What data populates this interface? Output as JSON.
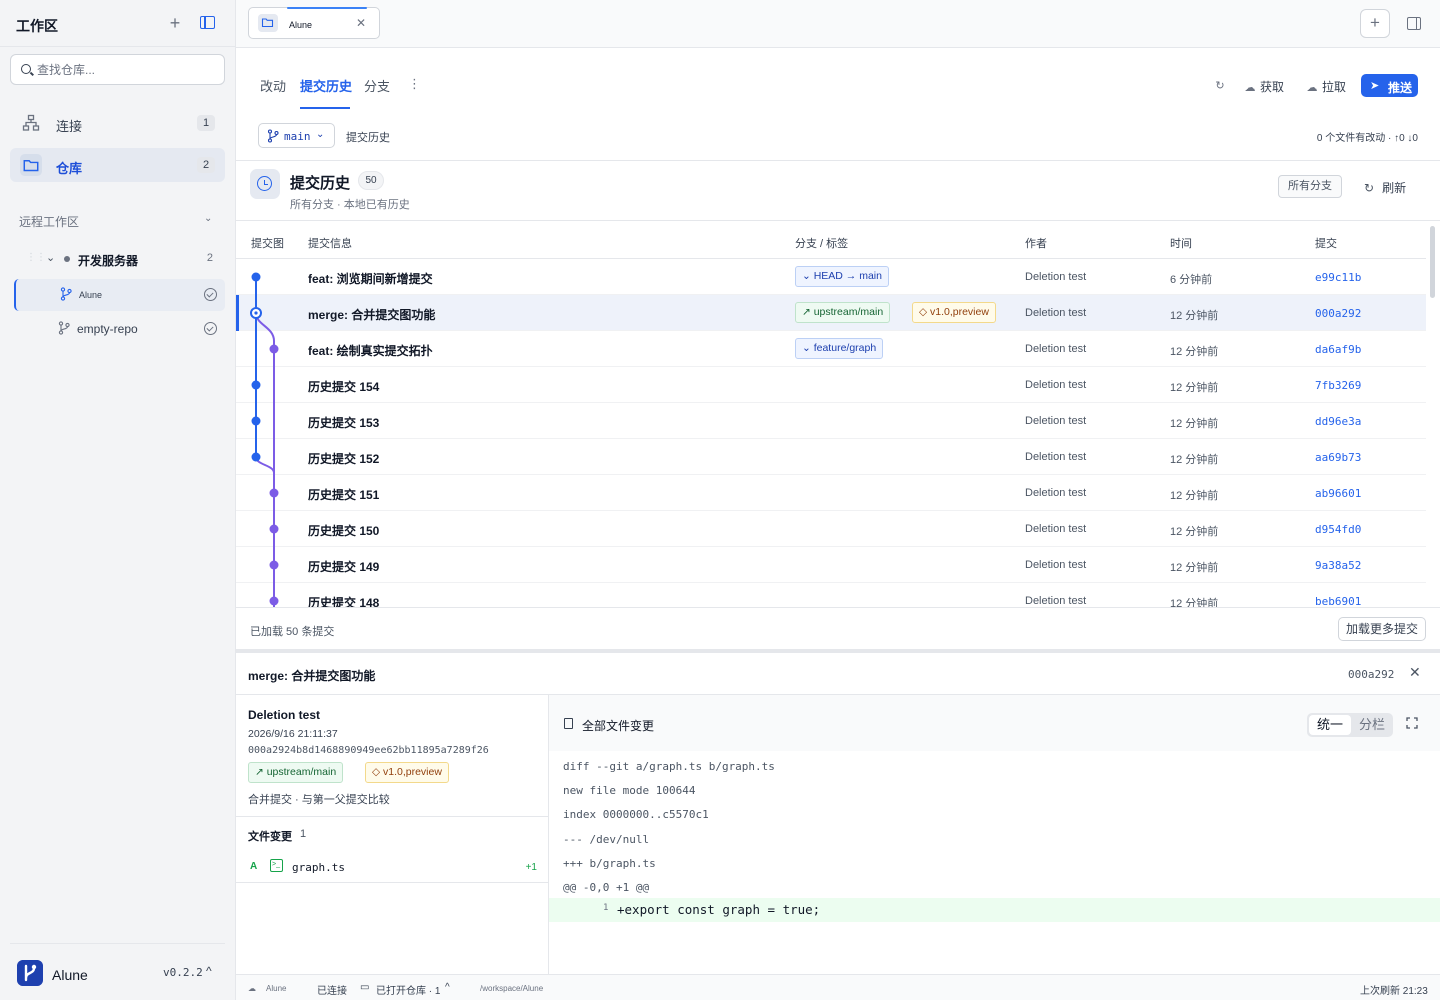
{
  "sidebar": {
    "title": "工作区",
    "search_placeholder": "查找仓库...",
    "nav": [
      {
        "label": "连接",
        "count": "1",
        "icon": "network-icon"
      },
      {
        "label": "仓库",
        "count": "2",
        "icon": "folder-icon"
      }
    ],
    "remote_section": "远程工作区",
    "server": {
      "label": "开发服务器",
      "count": "2"
    },
    "repos": [
      {
        "label": "Alune",
        "active": true
      },
      {
        "label": "empty-repo",
        "active": false
      }
    ],
    "footer": {
      "app_name": "Alune",
      "version": "v0.2.2"
    }
  },
  "tabbar": {
    "repo_tab": "Alune"
  },
  "subtabs": {
    "changes": "改动",
    "history": "提交历史",
    "branches": "分支",
    "fetch": "获取",
    "pull": "拉取",
    "push": "推送"
  },
  "branchbar": {
    "branch": "main",
    "crumb": "提交历史",
    "status": "0 个文件有改动 · ↑0 ↓0"
  },
  "history": {
    "title": "提交历史",
    "count": "50",
    "subtitle": "所有分支 · 本地已有历史",
    "all_branches": "所有分支",
    "refresh": "刷新"
  },
  "columns": {
    "graph": "提交图",
    "message": "提交信息",
    "refs": "分支 / 标签",
    "author": "作者",
    "time": "时间",
    "commit": "提交"
  },
  "commits": [
    {
      "message": "feat: 浏览期间新增提交",
      "refs": [
        {
          "kind": "head",
          "text": "⌄ HEAD → main"
        }
      ],
      "author": "Deletion test",
      "time": "6 分钟前",
      "hash": "e99c11b"
    },
    {
      "message": "merge: 合并提交图功能",
      "refs": [
        {
          "kind": "up",
          "text": "↗ upstream/main"
        },
        {
          "kind": "ver",
          "text": "◇ v1.0,preview"
        }
      ],
      "author": "Deletion test",
      "time": "12 分钟前",
      "hash": "000a292",
      "selected": true
    },
    {
      "message": "feat: 绘制真实提交拓扑",
      "refs": [
        {
          "kind": "head",
          "text": "⌄ feature/graph"
        }
      ],
      "author": "Deletion test",
      "time": "12 分钟前",
      "hash": "da6af9b"
    },
    {
      "message": "历史提交 154",
      "refs": [],
      "author": "Deletion test",
      "time": "12 分钟前",
      "hash": "7fb3269"
    },
    {
      "message": "历史提交 153",
      "refs": [],
      "author": "Deletion test",
      "time": "12 分钟前",
      "hash": "dd96e3a"
    },
    {
      "message": "历史提交 152",
      "refs": [],
      "author": "Deletion test",
      "time": "12 分钟前",
      "hash": "aa69b73"
    },
    {
      "message": "历史提交 151",
      "refs": [],
      "author": "Deletion test",
      "time": "12 分钟前",
      "hash": "ab96601"
    },
    {
      "message": "历史提交 150",
      "refs": [],
      "author": "Deletion test",
      "time": "12 分钟前",
      "hash": "d954fd0"
    },
    {
      "message": "历史提交 149",
      "refs": [],
      "author": "Deletion test",
      "time": "12 分钟前",
      "hash": "9a38a52"
    },
    {
      "message": "历史提交 148",
      "refs": [],
      "author": "Deletion test",
      "time": "12 分钟前",
      "hash": "beb6901"
    }
  ],
  "list_footer": {
    "loaded": "已加载 50 条提交",
    "load_more": "加载更多提交"
  },
  "detail": {
    "title": "merge: 合并提交图功能",
    "hash": "000a292",
    "author": "Deletion test",
    "date": "2026/9/16 21:11:37",
    "full_hash": "000a2924b8d1468890949ee62bb11895a7289f26",
    "refs": [
      {
        "kind": "up",
        "text": "↗ upstream/main"
      },
      {
        "kind": "ver",
        "text": "◇ v1.0,preview"
      }
    ],
    "note": "合并提交 · 与第一父提交比较",
    "files_label": "文件变更",
    "files_count": "1",
    "files": [
      {
        "status": "A",
        "name": "graph.ts",
        "additions": "+1"
      }
    ],
    "diff_title": "全部文件变更",
    "view_unified": "统一",
    "view_split": "分栏",
    "diff_lines": [
      "diff --git a/graph.ts b/graph.ts",
      "new file mode 100644",
      "index 0000000..c5570c1",
      "--- /dev/null",
      "+++ b/graph.ts",
      "@@ -0,0 +1 @@"
    ],
    "added_line_no": "1",
    "added_line": "+export const graph = true;"
  },
  "statusbar": {
    "repo": "Alune",
    "connected": "已连接",
    "open_repos": "已打开仓库 · 1",
    "path": "/workspace/Alune",
    "last_refresh": "上次刷新 21:23"
  },
  "colors": {
    "accent": "#2563eb",
    "branch_lane": "#7c5ce6",
    "added": "#16a34a"
  }
}
